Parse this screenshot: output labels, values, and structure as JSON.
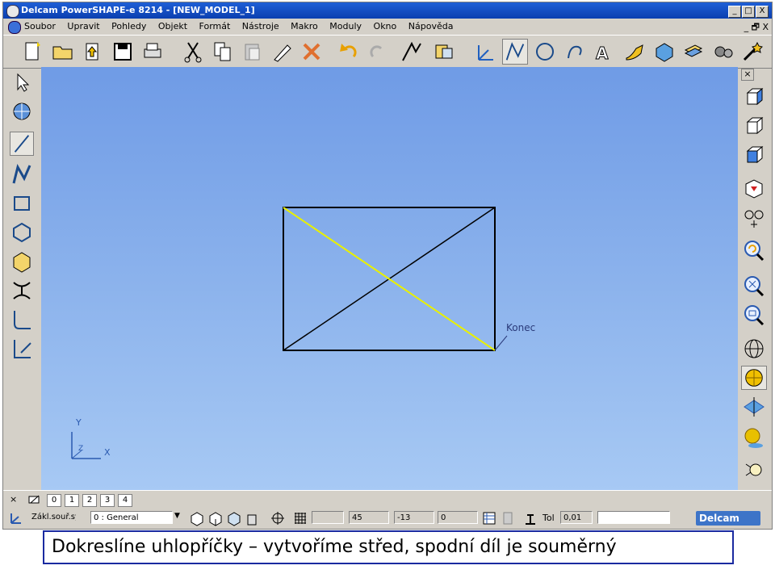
{
  "window": {
    "title": "Delcam PowerSHAPE-e 8214 - [NEW_MODEL_1]",
    "min_label": "_",
    "max_label": "□",
    "close_label": "X"
  },
  "menu": {
    "items": [
      "Soubor",
      "Upravit",
      "Pohledy",
      "Objekt",
      "Formát",
      "Nástroje",
      "Makro",
      "Moduly",
      "Okno",
      "Nápověda"
    ],
    "doc_controls": "_ 🗗 X"
  },
  "toolbar": {
    "icons": [
      "new-file-icon",
      "open-folder-icon",
      "import-icon",
      "save-icon",
      "print-icon",
      "cut-icon",
      "copy-icon",
      "paste-icon",
      "edit-icon",
      "delete-icon",
      "undo-icon",
      "redo-icon",
      "selection-icon",
      "dimension-icon",
      "workplane-icon",
      "line-icon",
      "circle-icon",
      "arc-icon",
      "text-icon",
      "curve-icon",
      "surface-icon",
      "solid-icon",
      "assembly-icon",
      "wizard-icon"
    ]
  },
  "left_toolbar": {
    "icons": [
      "pointer-icon",
      "transform-icon",
      "single-line-icon",
      "continuous-line-icon",
      "rectangle-icon",
      "polygon-icon",
      "box-icon",
      "fillet-line-icon",
      "corner-icon",
      "offset-corner-icon"
    ]
  },
  "right_toolbar": {
    "close_label": "×",
    "icons": [
      "view-iso1-icon",
      "view-iso2-icon",
      "view-iso3-icon",
      "view-front-icon",
      "spin-view-icon",
      "zoom-previous-icon",
      "zoom-all-icon",
      "zoom-box-icon",
      "wireframe-icon",
      "shaded-icon",
      "dynamic-section-icon",
      "material-icon",
      "lighting-icon"
    ]
  },
  "canvas": {
    "annotation": "Konec",
    "axis_y": "Y",
    "axis_x": "X",
    "axis_z": "Z"
  },
  "status1": {
    "close_label": "×",
    "tabs": [
      "0",
      "1",
      "2",
      "3",
      "4"
    ]
  },
  "status2": {
    "workplane": "Zákl.souř.sy",
    "layer": "0  : General",
    "coord_1": "45",
    "coord_2": "-13",
    "coord_3": "0",
    "tol_label": "Tol",
    "tol_value": "0,01",
    "brand": "Delcam"
  },
  "caption": {
    "text": "Dokreslíne uhlopříčky – vytvoříme střed, spodní díl je souměrný"
  },
  "colors": {
    "canvas_top": "#6f9be6",
    "canvas_bottom": "#a7c9f4",
    "highlight_line": "#e8f000",
    "caption_border": "#1a2aa0"
  }
}
